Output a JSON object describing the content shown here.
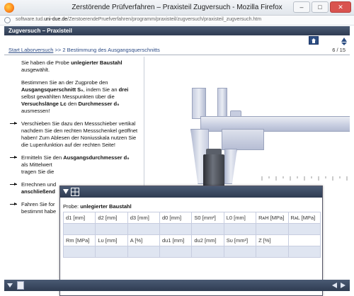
{
  "window": {
    "title": "Zerstörende Prüfverfahren – Praxisteil Zugversuch - Mozilla Firefox",
    "min": "–",
    "max": "□",
    "close": "✕"
  },
  "url": {
    "prefix": "software.tud.",
    "domain": "uni-due.de",
    "path": "/ZerstoerendePruefverfahren/programm/praxisteil/zugversuch/praxisteil_zugversuch.htm"
  },
  "app": {
    "header": "Zugversuch – Praxisteil"
  },
  "nav": {
    "start_link": "Start Laborversuch",
    "separator": " >> ",
    "current": "2 Bestimmung des Ausgangsquerschnitts",
    "page": "6 / 15"
  },
  "content": {
    "p1a": "Sie haben die Probe ",
    "p1b": "unlegierter Baustahl",
    "p1c": " ausgewählt.",
    "p2a": "Bestimmen Sie an der Zugprobe den ",
    "p2b": "Ausgangsquerschnitt S₀",
    "p2c": ", indem Sie an ",
    "p2d": "drei",
    "p2e": " selbst gewählten Messpunkten über die ",
    "p2f": "Versuchslänge Lᴄ",
    "p2g": " den ",
    "p2h": "Durchmesser d₀",
    "p2i": " ausmessen!",
    "i1": "Verschieben Sie dazu den Messschieber vertikal nachdem Sie den rechten Messschenkel geöffnet haben! Zum Ablesen der Noniusskala nutzen Sie die Lupenfunktion auf der rechten Seite!",
    "i2a": "Ermitteln Sie den ",
    "i2b": "Ausgangsdurchmesser d₀",
    "i2c": " als Mittelwert",
    "i2d": " tragen Sie die",
    "i3a": "Errechnen und",
    "i3b": "anschließend",
    "i4a": "Fahren Sie for",
    "i4b": "bestimmt habe"
  },
  "panel": {
    "probe_label": "Probe: ",
    "probe_value": "unlegierter Baustahl",
    "row1": [
      "d1 [mm]",
      "d2 [mm]",
      "d3 [mm]",
      "d0 [mm]",
      "S0 [mm²]",
      "L0 [mm]",
      "RᴀH [MPa]",
      "RᴀL [MPa]"
    ],
    "row2": [
      "Rm [MPa]",
      "Lᴜ [mm]",
      "A [%]",
      "du1 [mm]",
      "du2 [mm]",
      "Sᴜ [mm²]",
      "Z [%]",
      ""
    ]
  },
  "colors": {
    "header_bg": "#2f3c52",
    "link": "#2d4c86",
    "input_fill": "#dfe5f1"
  }
}
